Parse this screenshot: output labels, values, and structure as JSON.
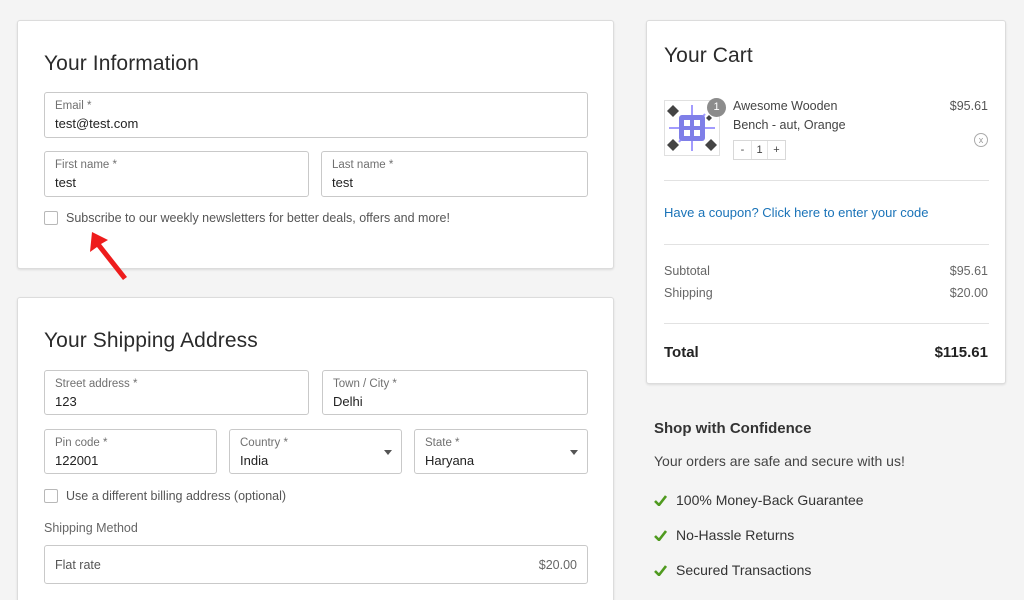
{
  "info": {
    "title": "Your Information",
    "email": {
      "label": "Email *",
      "value": "test@test.com"
    },
    "first_name": {
      "label": "First name *",
      "value": "test"
    },
    "last_name": {
      "label": "Last name *",
      "value": "test"
    },
    "newsletter": "Subscribe to our weekly newsletters for better deals, offers and more!"
  },
  "shipping": {
    "title": "Your Shipping Address",
    "street": {
      "label": "Street address *",
      "value": "123"
    },
    "city": {
      "label": "Town / City *",
      "value": "Delhi"
    },
    "pin": {
      "label": "Pin code *",
      "value": "122001"
    },
    "country": {
      "label": "Country *",
      "value": "India"
    },
    "state": {
      "label": "State *",
      "value": "Haryana"
    },
    "billing_toggle": "Use a different billing address (optional)",
    "method_label": "Shipping Method",
    "method": {
      "name": "Flat rate",
      "price": "$20.00"
    }
  },
  "cart": {
    "title": "Your Cart",
    "item": {
      "badge": "1",
      "name_line1": "Awesome Wooden",
      "name_line2": "Bench - aut, Orange",
      "price": "$95.61",
      "qty_minus": "-",
      "qty": "1",
      "qty_plus": "+",
      "remove": "x"
    },
    "coupon": "Have a coupon? Click here to enter your code",
    "subtotal_label": "Subtotal",
    "subtotal": "$95.61",
    "shipping_label": "Shipping",
    "shipping": "$20.00",
    "total_label": "Total",
    "total": "$115.61"
  },
  "confidence": {
    "title": "Shop with Confidence",
    "subtitle": "Your orders are safe and secure with us!",
    "items": [
      "100% Money-Back Guarantee",
      "No-Hassle Returns",
      "Secured Transactions"
    ]
  },
  "colors": {
    "link": "#1a73b8",
    "check": "#4f9a1f",
    "arrow": "#ee1c1c"
  }
}
